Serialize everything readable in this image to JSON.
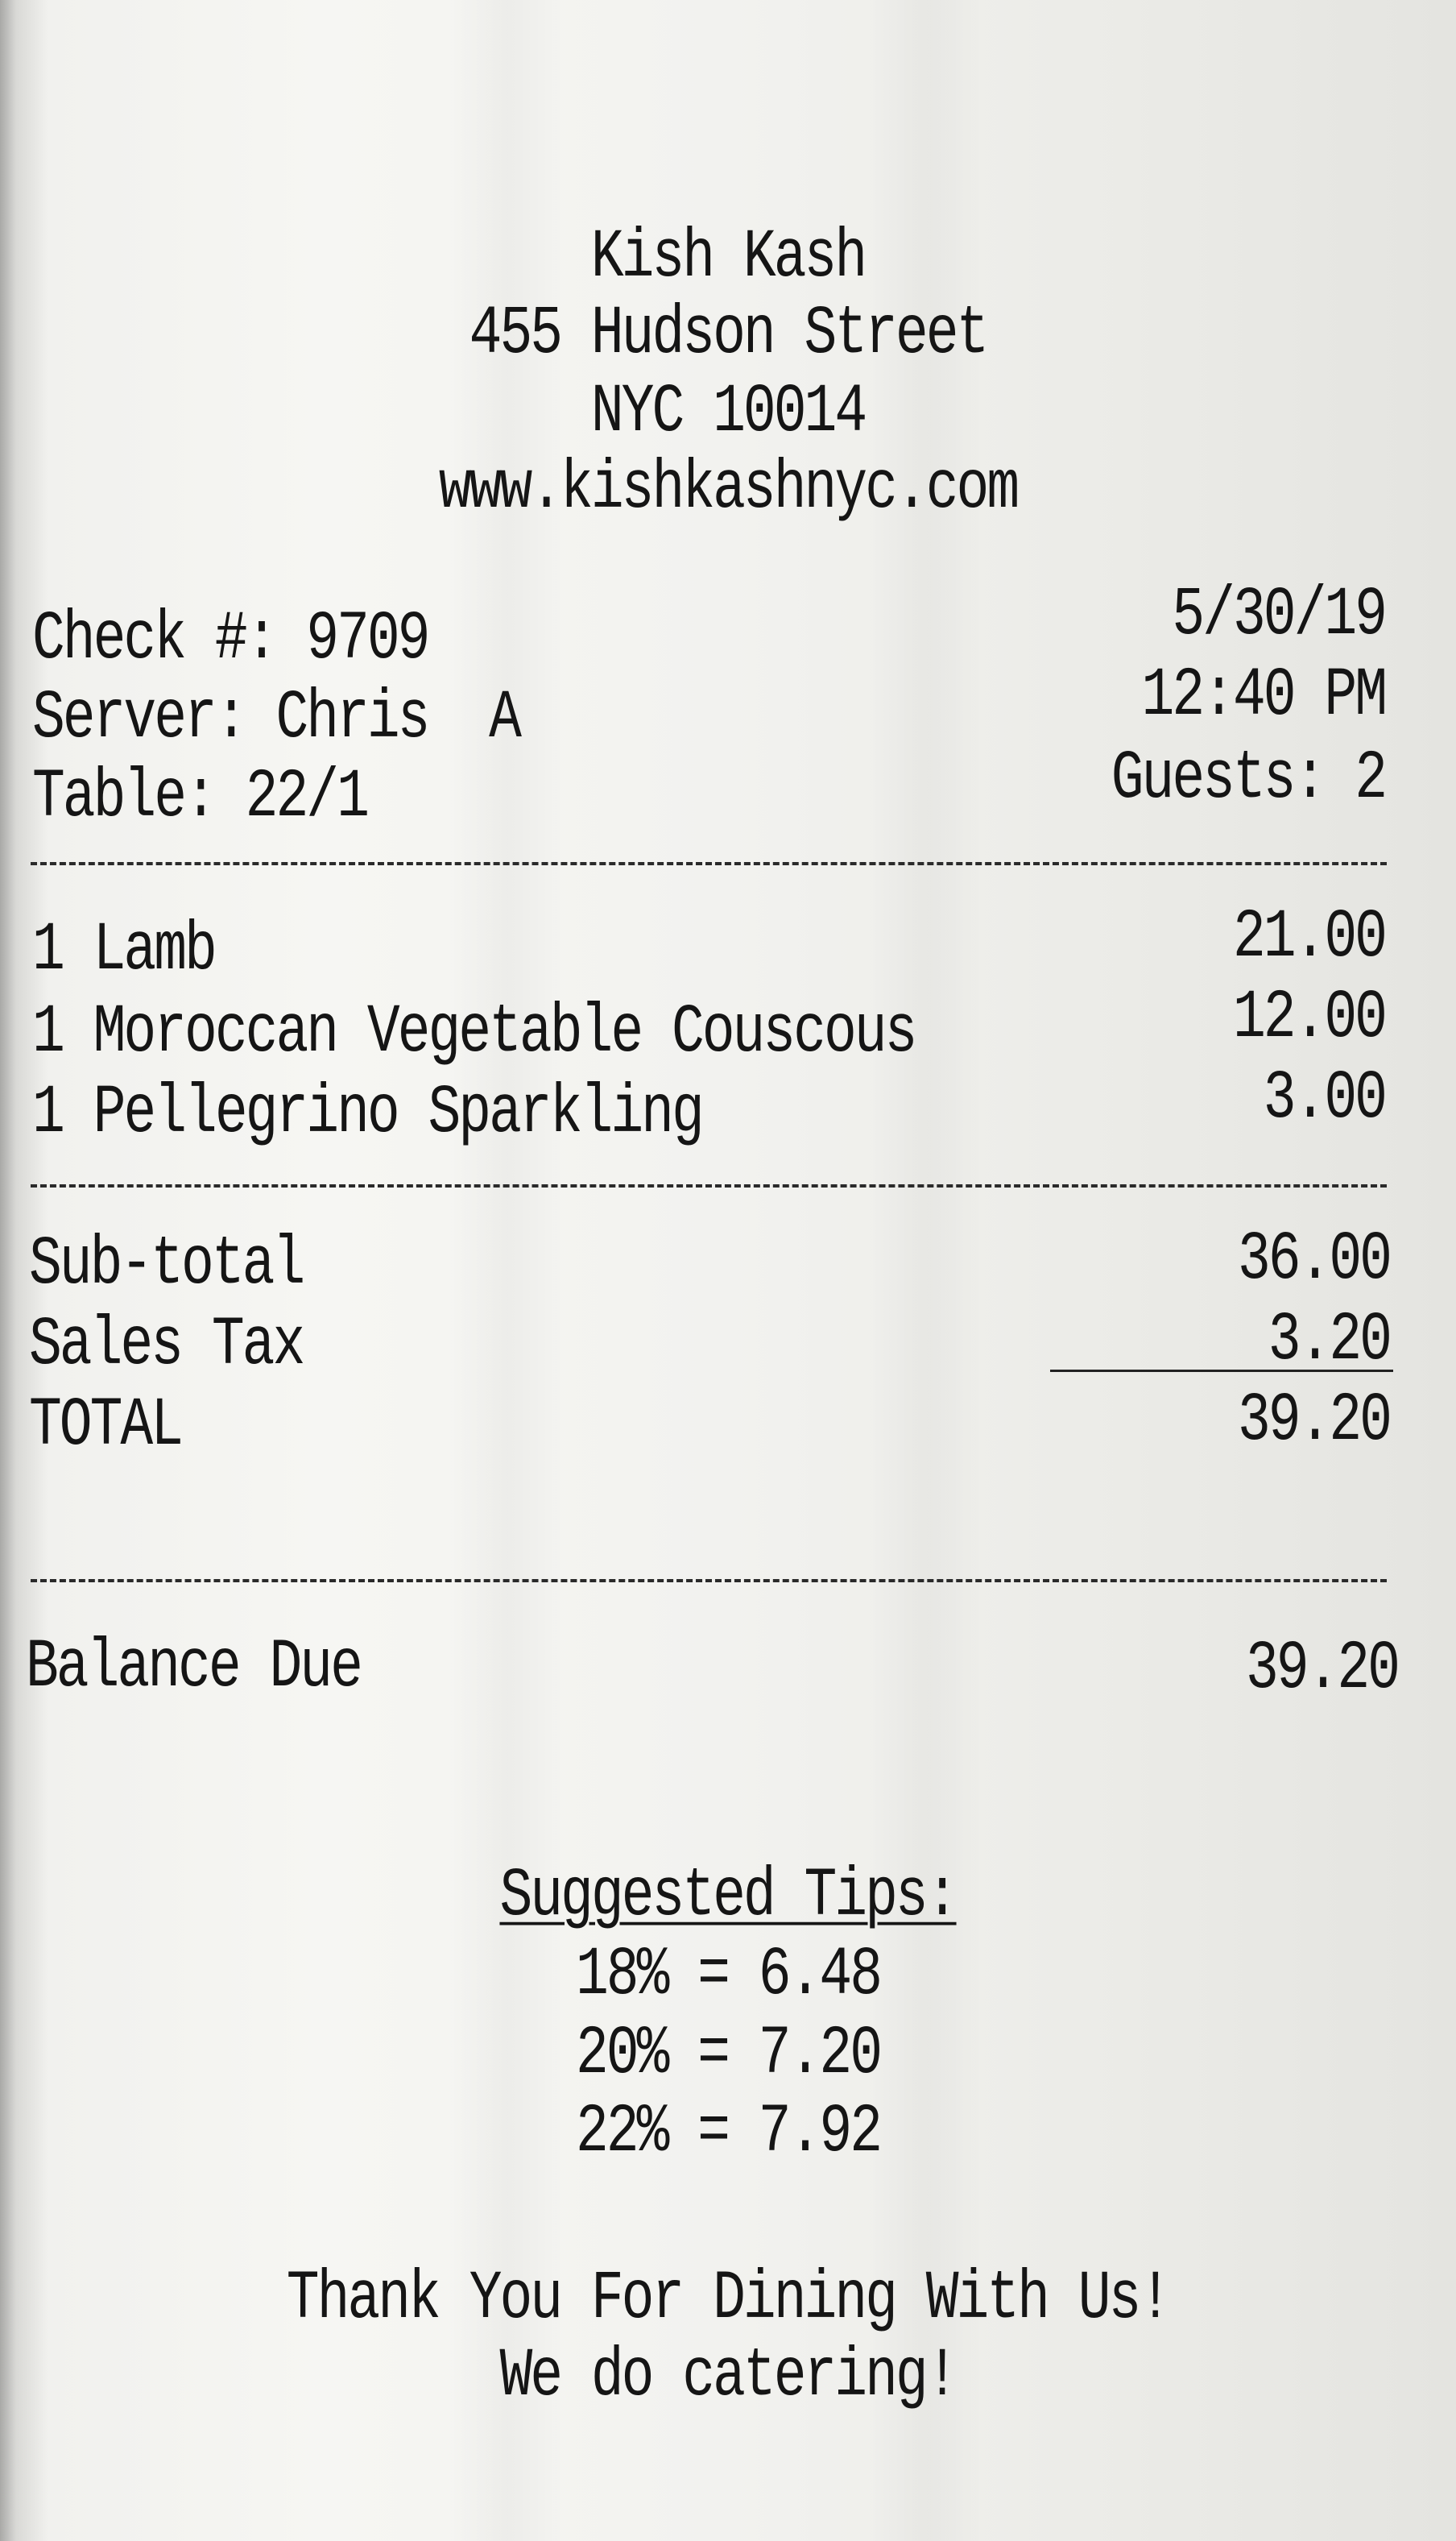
{
  "header": {
    "name": "Kish Kash",
    "address": "455 Hudson Street",
    "city": "NYC 10014",
    "website": "www.kishkashnyc.com"
  },
  "meta": {
    "check": "Check #: 9709",
    "server": "Server: Chris  A",
    "table": "Table: 22/1",
    "date": "5/30/19",
    "time": "12:40 PM",
    "guests": "Guests: 2"
  },
  "items": [
    {
      "name": "1 Lamb",
      "price": "21.00"
    },
    {
      "name": "1 Moroccan Vegetable Couscous",
      "price": "12.00"
    },
    {
      "name": "1 Pellegrino Sparkling",
      "price": "3.00"
    }
  ],
  "totals": {
    "subtotal_label": "Sub-total",
    "subtotal_value": "36.00",
    "tax_label": "Sales Tax",
    "tax_value": "3.20",
    "total_label": "TOTAL",
    "total_value": "39.20"
  },
  "balance": {
    "label": "Balance Due",
    "value": "39.20"
  },
  "tips": {
    "heading": "Suggested Tips:",
    "lines": [
      "18% = 6.48",
      "20% = 7.20",
      "22% = 7.92"
    ]
  },
  "footer": {
    "thanks": "Thank You For Dining With Us!",
    "catering": "We do catering!"
  }
}
